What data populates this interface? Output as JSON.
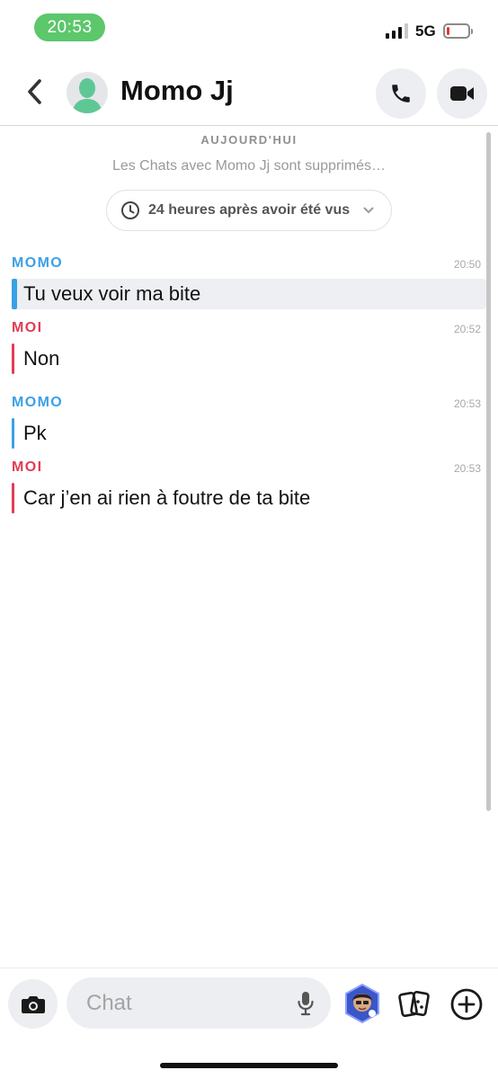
{
  "status_bar": {
    "time": "20:53",
    "network": "5G",
    "battery_level": 0.12
  },
  "header": {
    "contact_name": "Momo Jj",
    "icons": {
      "back": "chevron-left-icon",
      "avatar": "person-silhouette-icon",
      "call": "phone-icon",
      "video": "video-camera-icon"
    }
  },
  "chat": {
    "date_label": "AUJOURD'HUI",
    "info_text": "Les Chats avec Momo Jj sont supprimés…",
    "timer_label": "24 heures après avoir été vus",
    "messages": [
      {
        "sender": "MOMO",
        "time": "20:50",
        "text": "Tu veux voir ma bite"
      },
      {
        "sender": "MOI",
        "time": "20:52",
        "text": "Non"
      },
      {
        "sender": "MOMO",
        "time": "20:53",
        "text": "Pk"
      },
      {
        "sender": "MOI",
        "time": "20:53",
        "text": "Car j’en ai rien à foutre de ta bite"
      }
    ]
  },
  "input_bar": {
    "placeholder": "Chat",
    "icons": {
      "camera": "camera-icon",
      "mic": "microphone-icon",
      "bitmoji": "bitmoji-sticker-icon",
      "cards": "cards-icon",
      "plus": "plus-circle-icon"
    }
  },
  "colors": {
    "momo": "#3ba0e6",
    "moi": "#e03c55",
    "time_pill": "#5cc76b",
    "battery_low": "#e5362f"
  }
}
